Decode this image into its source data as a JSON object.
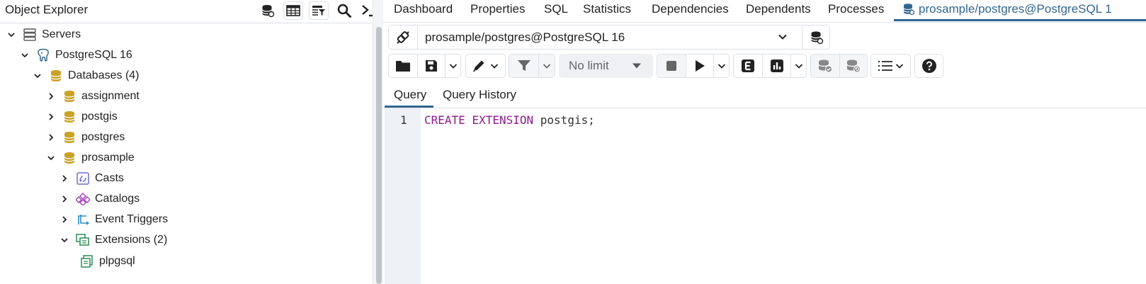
{
  "object_explorer": {
    "title": "Object Explorer",
    "toolbar": [
      "database-icon",
      "table-view-icon",
      "filtered-rows-icon",
      "search-icon",
      "terminal-icon"
    ]
  },
  "tree": [
    {
      "label": "Servers",
      "level": 0,
      "expanded": true,
      "icon": "servers-icon"
    },
    {
      "label": "PostgreSQL 16",
      "level": 1,
      "expanded": true,
      "icon": "postgresql-elephant-icon"
    },
    {
      "label": "Databases (4)",
      "level": 2,
      "expanded": true,
      "icon": "databases-icon"
    },
    {
      "label": "assignment",
      "level": 3,
      "expanded": false,
      "icon": "database-icon"
    },
    {
      "label": "postgis",
      "level": 3,
      "expanded": false,
      "icon": "database-icon"
    },
    {
      "label": "postgres",
      "level": 3,
      "expanded": false,
      "icon": "database-icon"
    },
    {
      "label": "prosample",
      "level": 3,
      "expanded": true,
      "icon": "database-icon"
    },
    {
      "label": "Casts",
      "level": 4,
      "expanded": false,
      "icon": "casts-icon"
    },
    {
      "label": "Catalogs",
      "level": 4,
      "expanded": false,
      "icon": "catalogs-icon"
    },
    {
      "label": "Event Triggers",
      "level": 4,
      "expanded": false,
      "icon": "event-triggers-icon"
    },
    {
      "label": "Extensions (2)",
      "level": 4,
      "expanded": true,
      "icon": "extensions-icon"
    },
    {
      "label": "plpgsql",
      "level": 5,
      "expanded": null,
      "icon": "extension-item-icon"
    }
  ],
  "tabs": [
    {
      "label": "Dashboard"
    },
    {
      "label": "Properties"
    },
    {
      "label": "SQL"
    },
    {
      "label": "Statistics"
    },
    {
      "label": "Dependencies"
    },
    {
      "label": "Dependents"
    },
    {
      "label": "Processes"
    },
    {
      "label": "prosample/postgres@PostgreSQL 1",
      "active": true
    }
  ],
  "connection": {
    "value": "prosample/postgres@PostgreSQL 16"
  },
  "query_toolbar": {
    "limit": "No limit"
  },
  "query_tabs": [
    "Query",
    "Query History"
  ],
  "editor": {
    "line_number": "1",
    "keyword1": "CREATE",
    "keyword2": "EXTENSION",
    "identifier": "postgis;"
  },
  "colors": {
    "accent": "#326690",
    "keyword": "#8b1b8c",
    "db_icon": "#c9a227"
  }
}
